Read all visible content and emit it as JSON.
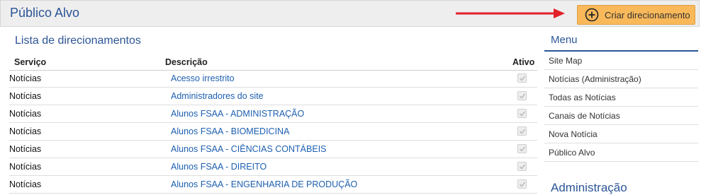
{
  "header": {
    "title": "Público Alvo",
    "create_button_label": "Criar direcionamento",
    "create_icon": "plus-circle-icon"
  },
  "list": {
    "title": "Lista de direcionamentos",
    "columns": {
      "service": "Serviço",
      "description": "Descrição",
      "active": "Ativo"
    },
    "rows": [
      {
        "service": "Notícias",
        "description": "Acesso irrestrito",
        "active": true
      },
      {
        "service": "Notícias",
        "description": "Administradores do site",
        "active": true
      },
      {
        "service": "Notícias",
        "description": "Alunos FSAA - ADMINISTRAÇÃO",
        "active": true
      },
      {
        "service": "Notícias",
        "description": "Alunos FSAA - BIOMEDICINA",
        "active": true
      },
      {
        "service": "Notícias",
        "description": "Alunos FSAA - CIÊNCIAS CONTÁBEIS",
        "active": true
      },
      {
        "service": "Notícias",
        "description": "Alunos FSAA - DIREITO",
        "active": true
      },
      {
        "service": "Notícias",
        "description": "Alunos FSAA - ENGENHARIA DE PRODUÇÃO",
        "active": true
      }
    ]
  },
  "sidebar": {
    "menu_title": "Menu",
    "items": [
      {
        "label": "Site Map"
      },
      {
        "label": "Notícias (Administração)"
      },
      {
        "label": "Todas as Notícias"
      },
      {
        "label": "Canais de Notícias"
      },
      {
        "label": "Nova Notícia"
      },
      {
        "label": "Público Alvo"
      }
    ],
    "admin_title": "Administração"
  },
  "colors": {
    "accent_blue": "#2c5597",
    "link_blue": "#1d5fb0",
    "button_orange": "#f9b85a",
    "arrow_red": "#e3202a"
  }
}
